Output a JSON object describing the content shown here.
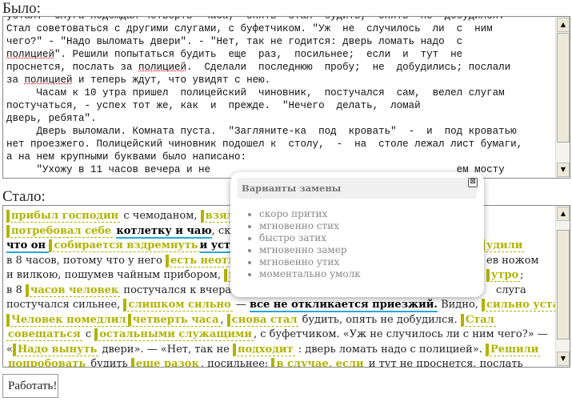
{
  "before": {
    "label": "Было:",
    "lines": [
      "устал.  Слуга подождал четверть  часа,  опять  стал  будить,  опять  не  добудился.",
      "Стал советоваться с другими слугами, с буфетчиком. \"Уж  не  случилось  ли  с  ним",
      "чего?\" - \"Надо выломать двери\". - \"Нет, так не годится: дверь ломать надо  с",
      "полицией\". Решили попытаться будить  еще  раз,  посильнее;  если  и  тут  не",
      "проснется, послать за полицией.  Сделали  последнюю  пробу;  не  добудились; послали",
      "за полицией и теперь ждут, что увидят с нею.",
      "     Часам к 10 утра пришел  полицейский  чиновник,  постучался  сам,  велел слугам",
      "постучаться, - успех тот же, как  и  прежде.  \"Нечего  делать,  ломай",
      "дверь, ребята\".",
      "     Дверь выломали. Комната пуста.  \"Загляните-ка  под  кровать\"  -  и  под кроватью",
      "нет проезжего. Полицейский чиновник подошел к  столу,  -  на  столе лежал лист бумаги,",
      "а на нем крупными буквами было написано:",
      "     \"Ухожу в 11 часов вечера и не                                         ем мосту"
    ]
  },
  "after": {
    "label": "Стало:"
  },
  "popup": {
    "title": "Варианты замены",
    "close": "⊠",
    "options": [
      "скоро притих",
      "мгновенно стих",
      "быстро затих",
      "мгновенно замер",
      "мгновенно утих",
      "моментально умолк"
    ]
  },
  "button": "Работать!",
  "t": {
    "l1a": "прибыл господин",
    "l1b": " с чемоданом, ",
    "l1c": "взял н",
    "l2a": "потребовал себе",
    "l2b": "котлетку и чаю",
    "l2c": ", ска",
    "l3a": "что он ",
    "l3b": "собирается вздремнуть",
    "l3c": "и уст",
    "l3d": "удили",
    "l4a": "в 8 часов, потому что у него ",
    "l4b": "есть неотло",
    "l4c": "ев ножом",
    "l5a": "и вилкою, пошумев чайным прибором, ",
    "l5b": "мг",
    "l5c": "утро",
    "l5d": ";",
    "l6a": "в 8 ",
    "l6b": "часов человек",
    "l6c": " постучался к вчераш",
    "l6d": "слуга",
    "l7a": "постучался сильнее, ",
    "l7b": "слишком сильно",
    "l7c": " — ",
    "l7d": "все не откликается приезжий.",
    "l7e": " Видно, ",
    "l7f": "сильно устал",
    "l7g": ".",
    "l8a": "Человек помедлил",
    "l8b": "четверть часа",
    "l8c": ", ",
    "l8d": "снова стал",
    "l8e": " будить, опять не добудился. ",
    "l8f": "Стал",
    "l9a": "совещаться",
    "l9b": " с ",
    "l9c": "остальными служащими",
    "l9d": ", с буфетчиком. «Уж не случилось ли с ним чего?» —",
    "l10a": "«",
    "l10b": "Надо вынуть",
    "l10c": " двери». — «Нет, так не ",
    "l10d": "подходит",
    "l10e": " : дверь ломать надо с полицией». ",
    "l10f": "Решили",
    "l11a": "попробовать",
    "l11b": " будить ",
    "l11c": "еще разок",
    "l11d": ", посильнее; ",
    "l11e": "в случае, если",
    "l11f": " и тут не проснется, послать"
  }
}
